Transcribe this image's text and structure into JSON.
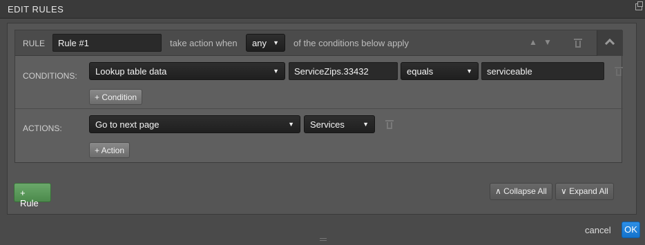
{
  "window": {
    "title": "EDIT RULES"
  },
  "rule": {
    "label": "RULE",
    "name": "Rule #1",
    "take_action_text": "take action when",
    "match_mode": "any",
    "conditions_text": "of the conditions below apply"
  },
  "conditions": {
    "label": "CONDITIONS:",
    "items": [
      {
        "source": "Lookup table data",
        "field": "ServiceZips.33432",
        "operator": "equals",
        "value": "serviceable"
      }
    ],
    "add_label": "+ Condition"
  },
  "actions": {
    "label": "ACTIONS:",
    "items": [
      {
        "action": "Go to next page",
        "target": "Services"
      }
    ],
    "add_label": "+ Action"
  },
  "toolbar": {
    "add_rule_label": "+ Rule",
    "collapse_all_label": "Collapse All",
    "expand_all_label": "Expand All"
  },
  "footer": {
    "cancel_label": "cancel",
    "ok_label": "OK"
  },
  "colors": {
    "ok_blue": "#1a7fd9",
    "add_rule_green": "#5a995a"
  }
}
